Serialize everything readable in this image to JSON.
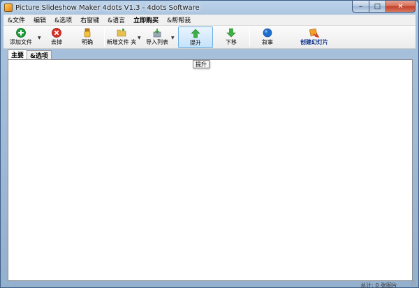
{
  "window": {
    "title": "Picture Slideshow Maker 4dots V1.3 - 4dots Software",
    "controls": {
      "minimize": "–",
      "maximize": "□",
      "close": "✕"
    }
  },
  "menu": [
    {
      "label": "&文件"
    },
    {
      "label": "编辑"
    },
    {
      "label": "&选项"
    },
    {
      "label": "右窗键"
    },
    {
      "label": "&语言"
    },
    {
      "label": "立即购买",
      "bold": true
    },
    {
      "label": "&帮帮我"
    }
  ],
  "toolbar": {
    "add_files": {
      "label": "添加文件",
      "icon": "add-icon",
      "color": "#1f9c3a"
    },
    "remove": {
      "label": "去掉",
      "icon": "remove-icon",
      "color": "#d93025"
    },
    "clear": {
      "label": "明确",
      "icon": "clear-icon",
      "color": "#e0a020"
    },
    "add_folder": {
      "label": "新增文件 夹",
      "icon": "folder-icon",
      "color": "#e8c050"
    },
    "import_list": {
      "label": "导入列表",
      "icon": "import-icon",
      "color": "#3aa03a"
    },
    "move_up": {
      "label": "提升",
      "icon": "up-arrow-icon",
      "color": "#3cb043"
    },
    "move_down": {
      "label": "下移",
      "icon": "down-arrow-icon",
      "color": "#3cb043"
    },
    "narrate": {
      "label": "叙事",
      "icon": "narrate-icon",
      "color": "#1e6fd0"
    },
    "create_slideshow": {
      "label": "创建幻灯片",
      "icon": "create-slideshow-icon",
      "color": "#e07020"
    }
  },
  "tabs": [
    {
      "label": "主要"
    },
    {
      "label": "&选项"
    }
  ],
  "tooltip": "提升",
  "status_text": "总计: 0 张图片"
}
